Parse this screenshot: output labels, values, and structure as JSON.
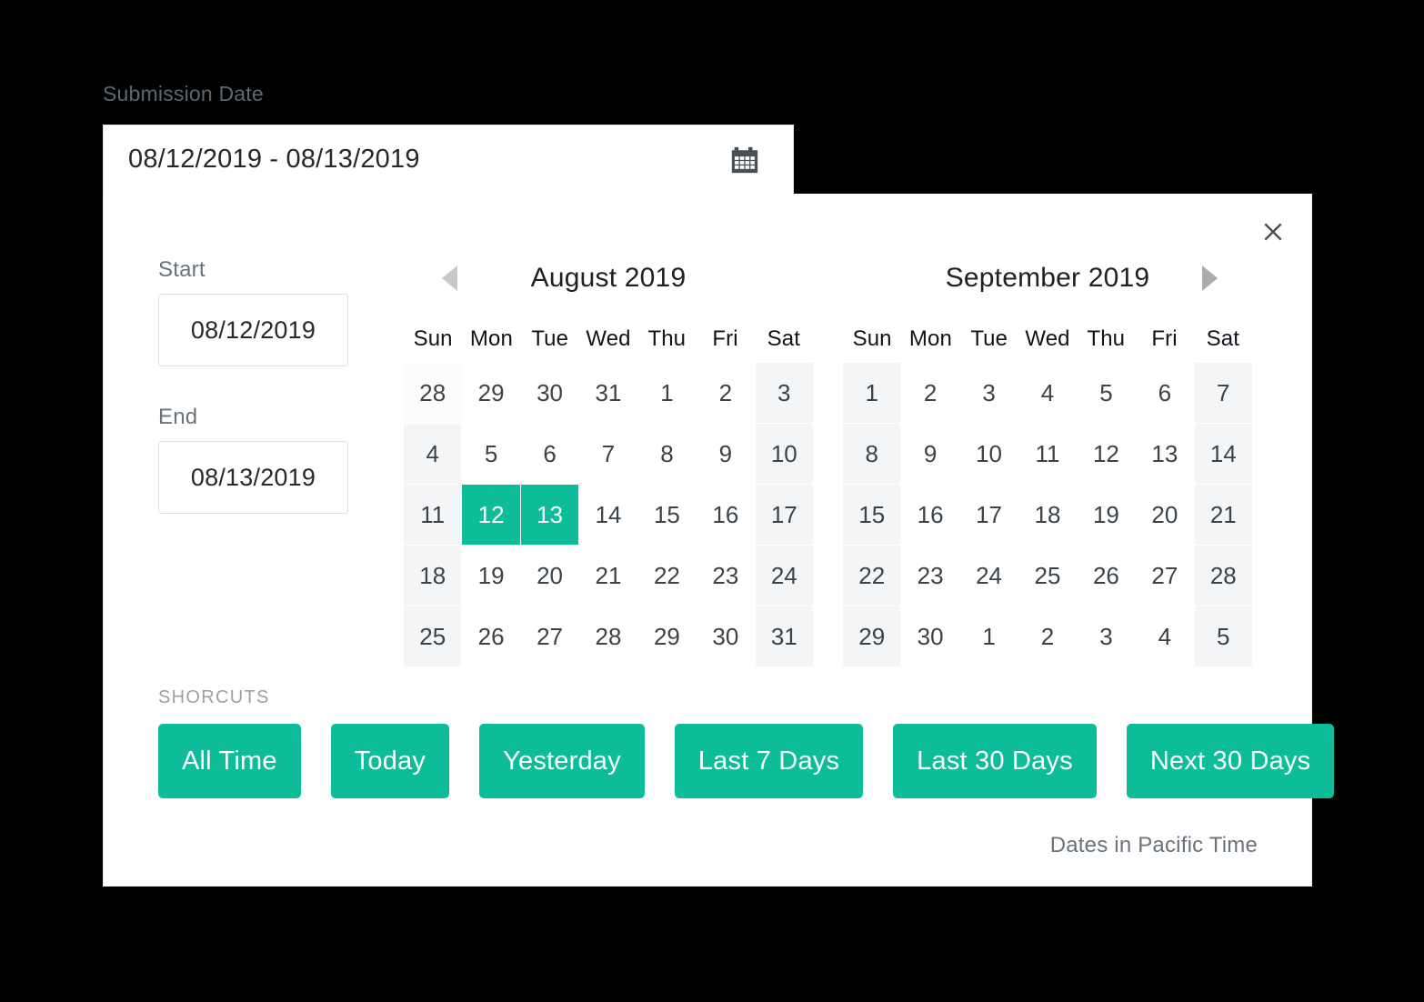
{
  "field": {
    "label": "Submission Date",
    "value": "08/12/2019 - 08/13/2019",
    "icon": "calendar-icon"
  },
  "panel": {
    "close_icon": "close-icon",
    "start": {
      "label": "Start",
      "value": "08/12/2019"
    },
    "end": {
      "label": "End",
      "value": "08/13/2019"
    },
    "shortcuts_label": "SHORCUTS",
    "shortcuts": [
      "All Time",
      "Today",
      "Yesterday",
      "Last 7 Days",
      "Last 30 Days",
      "Next 30 Days"
    ],
    "timezone_note": "Dates in Pacific Time",
    "prev_icon": "chevron-left-icon",
    "next_icon": "chevron-right-icon",
    "weekdays": [
      "Sun",
      "Mon",
      "Tue",
      "Wed",
      "Thu",
      "Fri",
      "Sat"
    ],
    "months": [
      {
        "title": "August 2019",
        "weeks": [
          [
            "28",
            "29",
            "30",
            "31",
            "1",
            "2",
            "3"
          ],
          [
            "4",
            "5",
            "6",
            "7",
            "8",
            "9",
            "10"
          ],
          [
            "11",
            "12",
            "13",
            "14",
            "15",
            "16",
            "17"
          ],
          [
            "18",
            "19",
            "20",
            "21",
            "22",
            "23",
            "24"
          ],
          [
            "25",
            "26",
            "27",
            "28",
            "29",
            "30",
            "31"
          ]
        ],
        "selected": [
          {
            "week": 2,
            "day": 1
          },
          {
            "week": 2,
            "day": 2
          }
        ]
      },
      {
        "title": "September 2019",
        "weeks": [
          [
            "1",
            "2",
            "3",
            "4",
            "5",
            "6",
            "7"
          ],
          [
            "8",
            "9",
            "10",
            "11",
            "12",
            "13",
            "14"
          ],
          [
            "15",
            "16",
            "17",
            "18",
            "19",
            "20",
            "21"
          ],
          [
            "22",
            "23",
            "24",
            "25",
            "26",
            "27",
            "28"
          ],
          [
            "29",
            "30",
            "1",
            "2",
            "3",
            "4",
            "5"
          ]
        ],
        "selected": []
      }
    ]
  },
  "colors": {
    "accent": "#0dbd9a",
    "weekend_bg": "#f4f5f7",
    "text": "#3c4348"
  }
}
